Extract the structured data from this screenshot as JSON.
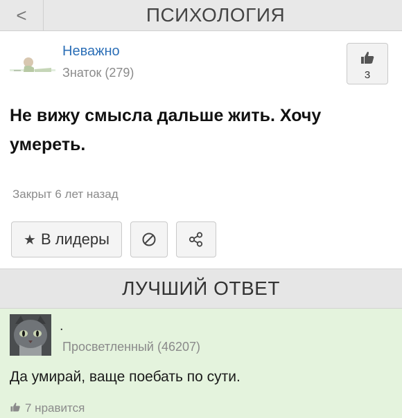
{
  "header": {
    "back_icon": "chevron-left-icon",
    "back_glyph": "<",
    "title": "ПСИХОЛОГИЯ"
  },
  "question": {
    "author_name": "Неважно",
    "author_rank": "Знаток (279)",
    "likes": "3",
    "text": "Не вижу смысла дальше жить. Хочу умереть.",
    "status": "Закрыт 6 лет назад"
  },
  "actions": {
    "leaders_label": "В лидеры",
    "star_icon": "star-icon",
    "report_icon": "report-icon",
    "share_icon": "share-icon"
  },
  "best_answer": {
    "section_title": "ЛУЧШИЙ ОТВЕТ",
    "author_name": ".",
    "author_rank": "Просветленный (46207)",
    "text": "Да умирай, ваще поебать по сути.",
    "likes_text": "7 нравится"
  },
  "colors": {
    "link": "#2c6fb7",
    "answer_bg": "#e4f3dd",
    "bar_bg": "#e6e6e6"
  }
}
